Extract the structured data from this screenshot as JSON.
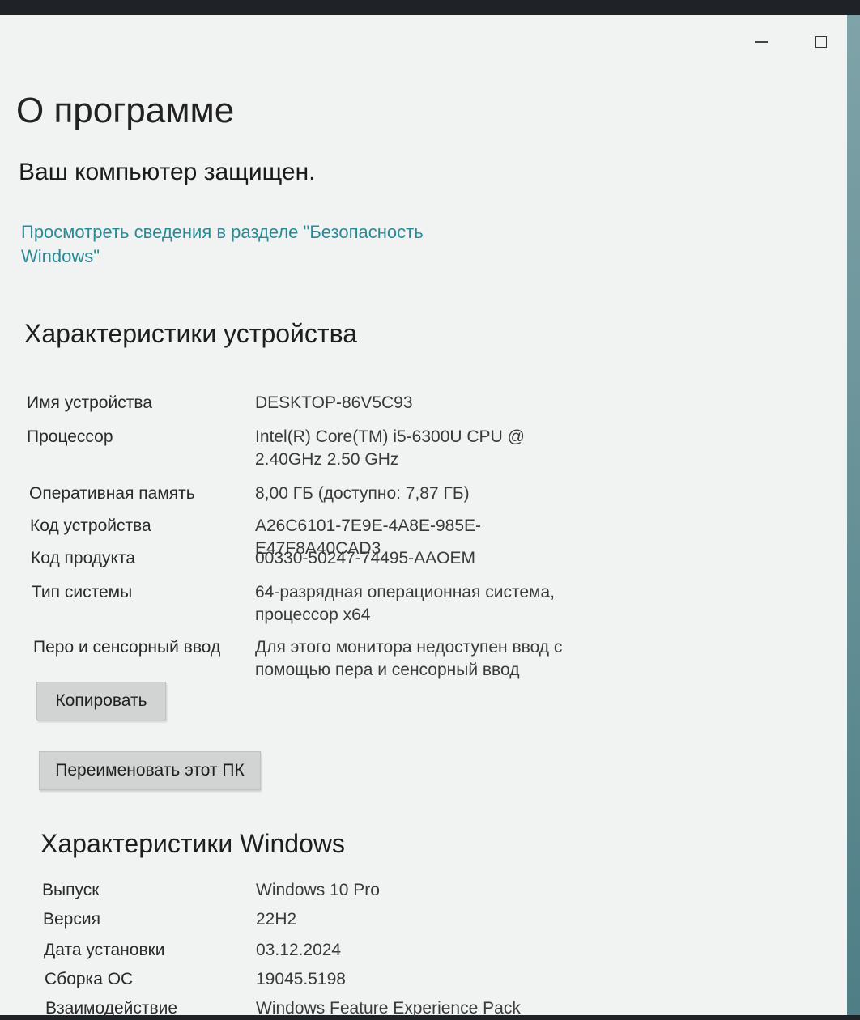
{
  "window": {
    "title": "О программе",
    "minimize_glyph": "—"
  },
  "security": {
    "status": "Ваш компьютер защищен.",
    "link": "Просмотреть сведения в разделе \"Безопасность Windows\""
  },
  "device": {
    "heading": "Характеристики устройства",
    "specs": [
      {
        "key": "Имя устройства",
        "value": "DESKTOP-86V5C93"
      },
      {
        "key": "Процессор",
        "value": "Intel(R) Core(TM) i5-6300U CPU @ 2.40GHz   2.50 GHz"
      },
      {
        "key": "Оперативная память",
        "value": "8,00 ГБ (доступно: 7,87 ГБ)"
      },
      {
        "key": "Код устройства",
        "value": "A26C6101-7E9E-4A8E-985E-E47F8A40CAD3"
      },
      {
        "key": "Код продукта",
        "value": "00330-50247-74495-AAOEM"
      },
      {
        "key": "Тип системы",
        "value": "64-разрядная операционная система, процессор x64"
      },
      {
        "key": "Перо и сенсорный ввод",
        "value": "Для этого монитора недоступен ввод с помощью пера и сенсорный ввод"
      }
    ],
    "copy_label": "Копировать",
    "rename_label": "Переименовать этот ПК"
  },
  "windows": {
    "heading": "Характеристики Windows",
    "specs": [
      {
        "key": "Выпуск",
        "value": "Windows 10 Pro"
      },
      {
        "key": "Версия",
        "value": "22H2"
      },
      {
        "key": "Дата установки",
        "value": "03.12.2024"
      },
      {
        "key": "Сборка ОС",
        "value": "19045.5198"
      },
      {
        "key": "Взаимодействие",
        "value": "Windows Feature Experience Pack"
      }
    ]
  }
}
